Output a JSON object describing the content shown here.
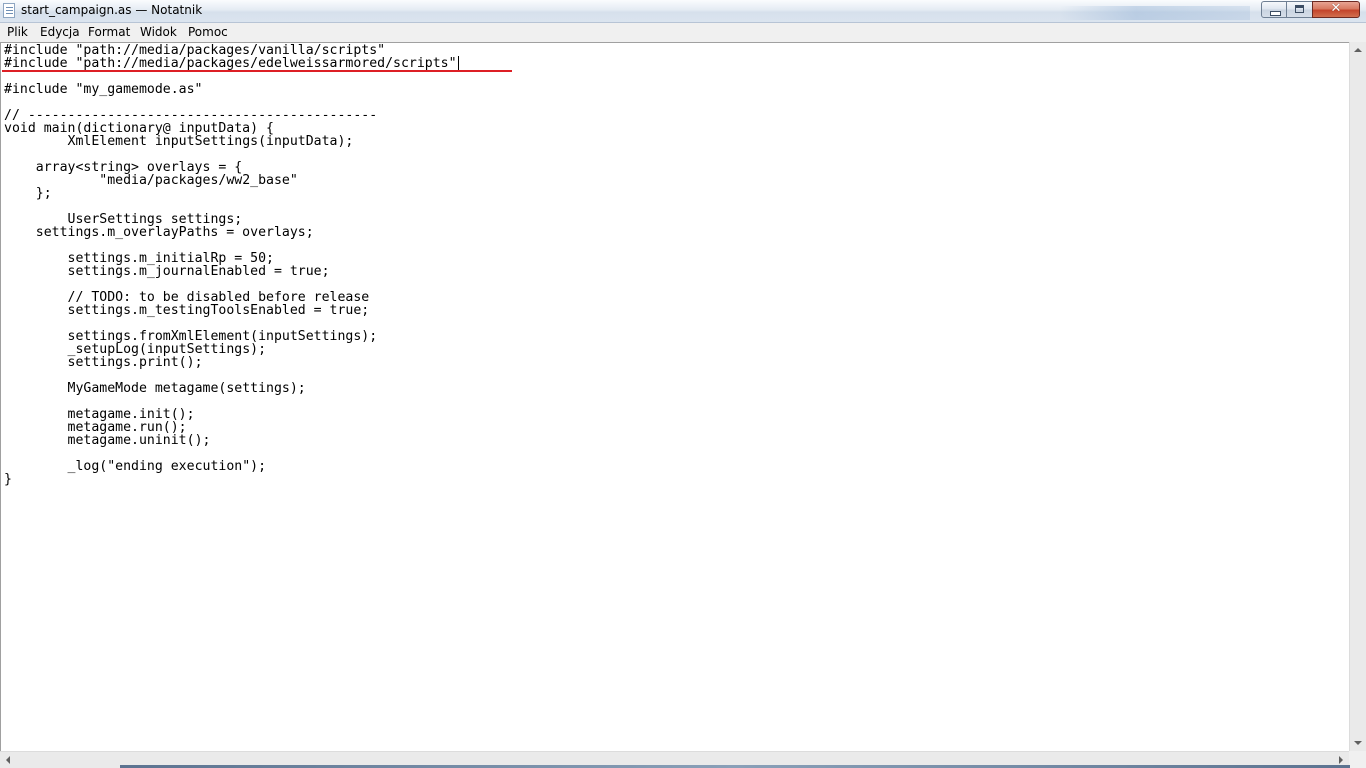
{
  "window": {
    "title": "start_campaign.as — Notatnik",
    "accent_color": "#dd1f25"
  },
  "title_bar": {
    "icons": [
      "notepad-icon",
      "minimize-icon",
      "maximize-icon",
      "close-icon"
    ],
    "close_glyph": "✕"
  },
  "menu": {
    "items": [
      "Plik",
      "Edycja",
      "Format",
      "Widok",
      "Pomoc"
    ]
  },
  "editor": {
    "lines": [
      "#include \"path://media/packages/vanilla/scripts\"",
      "#include \"path://media/packages/edelweissarmored/scripts\"",
      "",
      "#include \"my_gamemode.as\"",
      "",
      "// --------------------------------------------",
      "void main(dictionary@ inputData) {",
      "\tXmlElement inputSettings(inputData);",
      "",
      "    array<string> overlays = {",
      "\t    \"media/packages/ww2_base\"",
      "    };",
      "",
      "\tUserSettings settings;",
      "    settings.m_overlayPaths = overlays;",
      "",
      "\tsettings.m_initialRp = 50;",
      "\tsettings.m_journalEnabled = true;",
      "",
      "\t// TODO: to be disabled before release",
      "\tsettings.m_testingToolsEnabled = true;",
      "",
      "\tsettings.fromXmlElement(inputSettings);",
      "\t_setupLog(inputSettings);",
      "\tsettings.print();",
      "",
      "\tMyGameMode metagame(settings);",
      "",
      "\tmetagame.init();",
      "\tmetagame.run();",
      "\tmetagame.uninit();",
      "",
      "\t_log(\"ending execution\");",
      "}"
    ],
    "cursor_line": 2
  },
  "scrollbars": {
    "icons": [
      "arrow-up-icon",
      "arrow-down-icon",
      "arrow-left-icon",
      "arrow-right-icon"
    ]
  }
}
